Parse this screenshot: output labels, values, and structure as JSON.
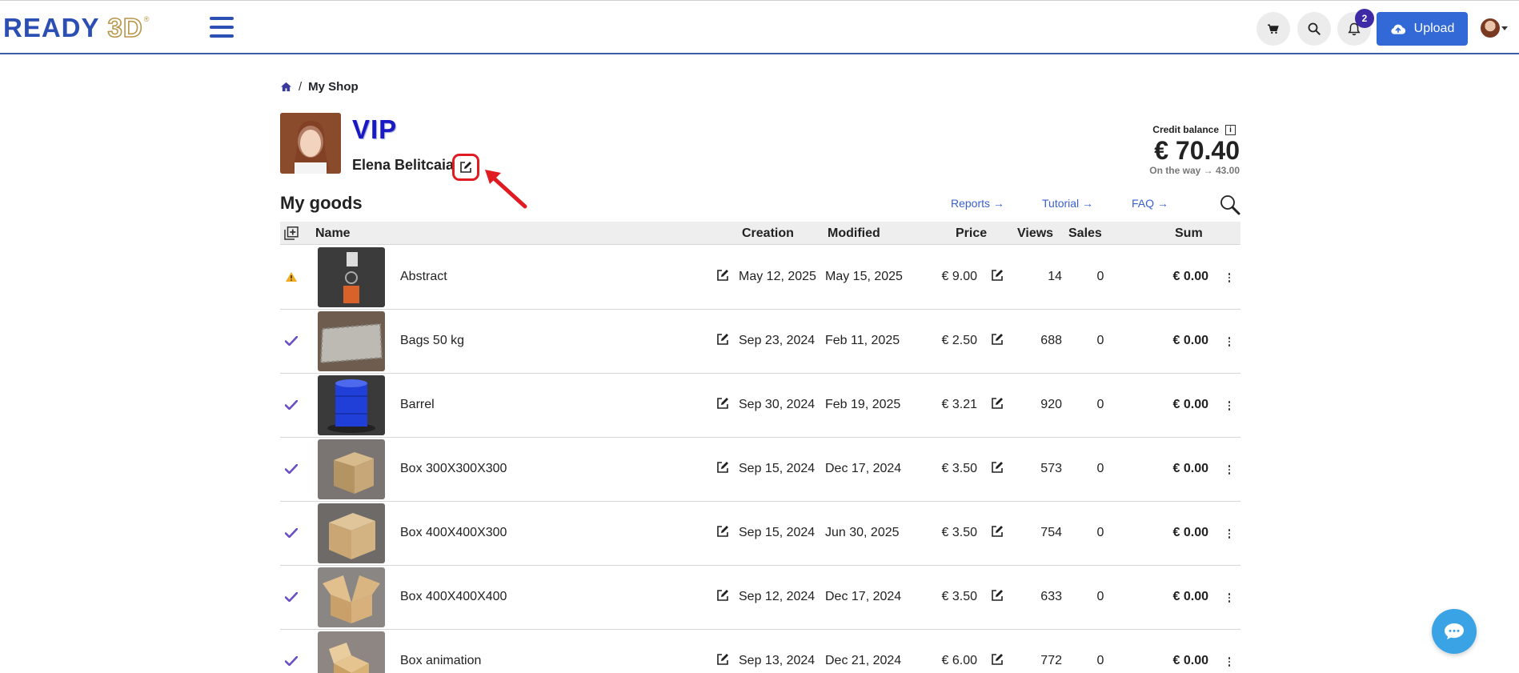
{
  "header": {
    "logo_ready": "READY",
    "logo_3d": "3D",
    "logo_reg": "®",
    "notification_count": "2",
    "upload_label": "Upload"
  },
  "breadcrumb": {
    "current": "My Shop"
  },
  "profile": {
    "status": "VIP",
    "name": "Elena Belitcaia"
  },
  "credit": {
    "label": "Credit balance",
    "info": "i",
    "value": "€ 70.40",
    "on_the_way": "On the way → 43.00"
  },
  "goods": {
    "title": "My goods",
    "links": {
      "reports": "Reports →",
      "tutorial": "Tutorial →",
      "faq": "FAQ →"
    },
    "columns": {
      "name": "Name",
      "creation": "Creation",
      "modified": "Modified",
      "price": "Price",
      "views": "Views",
      "sales": "Sales",
      "sum": "Sum"
    },
    "rows": [
      {
        "status": "warning",
        "name": "Abstract",
        "creation": "May 12, 2025",
        "modified": "May 15, 2025",
        "price": "€ 9.00",
        "views": "14",
        "sales": "0",
        "sum": "€ 0.00"
      },
      {
        "status": "ok",
        "name": "Bags 50 kg",
        "creation": "Sep 23, 2024",
        "modified": "Feb 11, 2025",
        "price": "€ 2.50",
        "views": "688",
        "sales": "0",
        "sum": "€ 0.00"
      },
      {
        "status": "ok",
        "name": "Barrel",
        "creation": "Sep 30, 2024",
        "modified": "Feb 19, 2025",
        "price": "€ 3.21",
        "views": "920",
        "sales": "0",
        "sum": "€ 0.00"
      },
      {
        "status": "ok",
        "name": "Box 300X300X300",
        "creation": "Sep 15, 2024",
        "modified": "Dec 17, 2024",
        "price": "€ 3.50",
        "views": "573",
        "sales": "0",
        "sum": "€ 0.00"
      },
      {
        "status": "ok",
        "name": "Box 400X400X300",
        "creation": "Sep 15, 2024",
        "modified": "Jun 30, 2025",
        "price": "€ 3.50",
        "views": "754",
        "sales": "0",
        "sum": "€ 0.00"
      },
      {
        "status": "ok",
        "name": "Box 400X400X400",
        "creation": "Sep 12, 2024",
        "modified": "Dec 17, 2024",
        "price": "€ 3.50",
        "views": "633",
        "sales": "0",
        "sum": "€ 0.00"
      },
      {
        "status": "ok",
        "name": "Box animation",
        "creation": "Sep 13, 2024",
        "modified": "Dec 21, 2024",
        "price": "€ 6.00",
        "views": "772",
        "sales": "0",
        "sum": "€ 0.00"
      }
    ]
  },
  "icons": {
    "cart": "cart-icon",
    "search": "search-icon",
    "bell": "bell-icon",
    "upload": "cloud-upload-icon",
    "home": "home-icon",
    "edit": "edit-icon",
    "chat": "chat-icon"
  },
  "colors": {
    "brand_blue": "#2c4fb4",
    "brand_gold": "#b8964a",
    "upload_button": "#3269d6",
    "badge": "#3e2aa6",
    "vip": "#1a1ac4",
    "link": "#3a5fd0",
    "annotation_red": "#e01b22",
    "check": "#6a4fc4",
    "warning": "#f0ad1e",
    "chat": "#3aa3e6"
  }
}
